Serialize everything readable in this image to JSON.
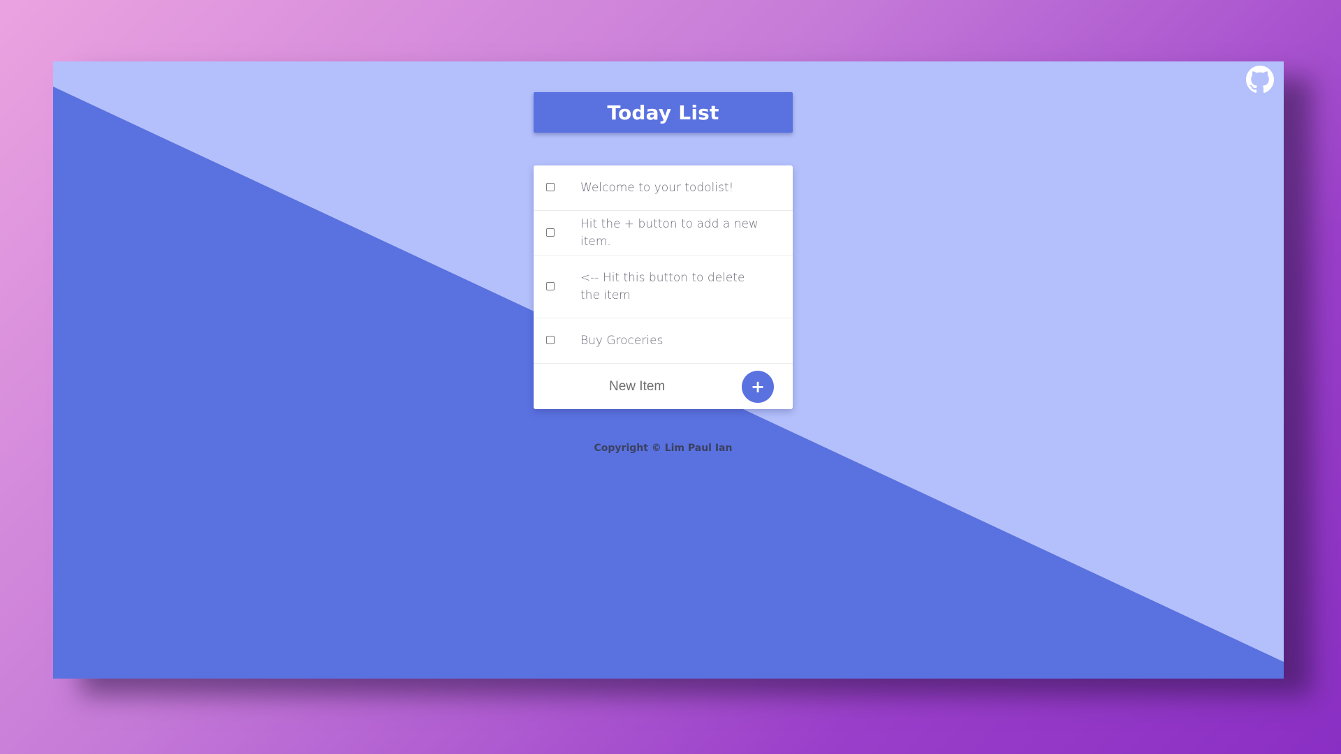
{
  "app": {
    "title": "Today List"
  },
  "header": {
    "github_icon": "github-icon"
  },
  "todo": {
    "items": [
      {
        "label": "Welcome to your todolist!",
        "checked": false
      },
      {
        "label": "Hit the + button to add a new item.",
        "checked": false
      },
      {
        "label": "<-- Hit this button to delete the item",
        "checked": false
      },
      {
        "label": "Buy Groceries",
        "checked": false
      }
    ],
    "new_item": {
      "placeholder": "New Item",
      "value": "",
      "add_label": "+"
    }
  },
  "footer": {
    "copyright": "Copyright © Lim Paul Ian"
  },
  "colors": {
    "accent": "#5a71e0",
    "light_background": "#b4c0fb",
    "page_gradient_start": "#eba3e0",
    "page_gradient_end": "#8a2fc3"
  }
}
